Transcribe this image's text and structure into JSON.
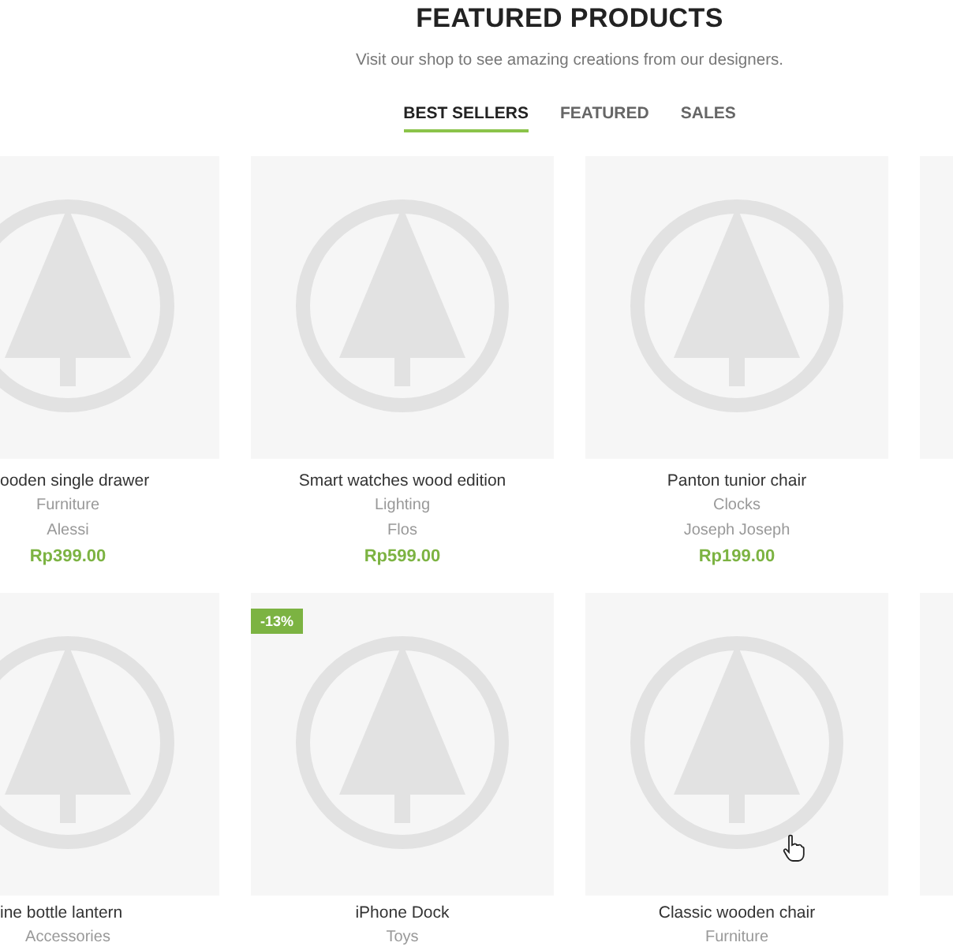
{
  "title": "FEATURED PRODUCTS",
  "subtitle": "Visit our shop to see amazing creations from our designers.",
  "tabs": [
    {
      "label": "BEST SELLERS",
      "selected": true
    },
    {
      "label": "FEATURED",
      "selected": false
    },
    {
      "label": "SALES",
      "selected": false
    }
  ],
  "product_rows": [
    {
      "products": [
        {
          "kind": "card",
          "name": "ooden single drawer",
          "category": "Furniture",
          "brand": "Alessi",
          "price": "Rp399.00"
        },
        {
          "kind": "card",
          "name": "Smart watches wood edition",
          "category": "Lighting",
          "brand": "Flos",
          "price": "Rp599.00"
        },
        {
          "kind": "card",
          "name": "Panton tunior chair",
          "category": "Clocks",
          "brand": "Joseph Joseph",
          "price": "Rp199.00"
        },
        {
          "kind": "image_only"
        }
      ]
    },
    {
      "products": [
        {
          "kind": "card",
          "name": "ine bottle lantern",
          "category": "Accessories"
        },
        {
          "kind": "card",
          "name": "iPhone Dock",
          "category": "Toys",
          "badge": "-13%"
        },
        {
          "kind": "card",
          "name": "Classic wooden chair",
          "category": "Furniture"
        },
        {
          "kind": "image_only"
        }
      ]
    }
  ]
}
